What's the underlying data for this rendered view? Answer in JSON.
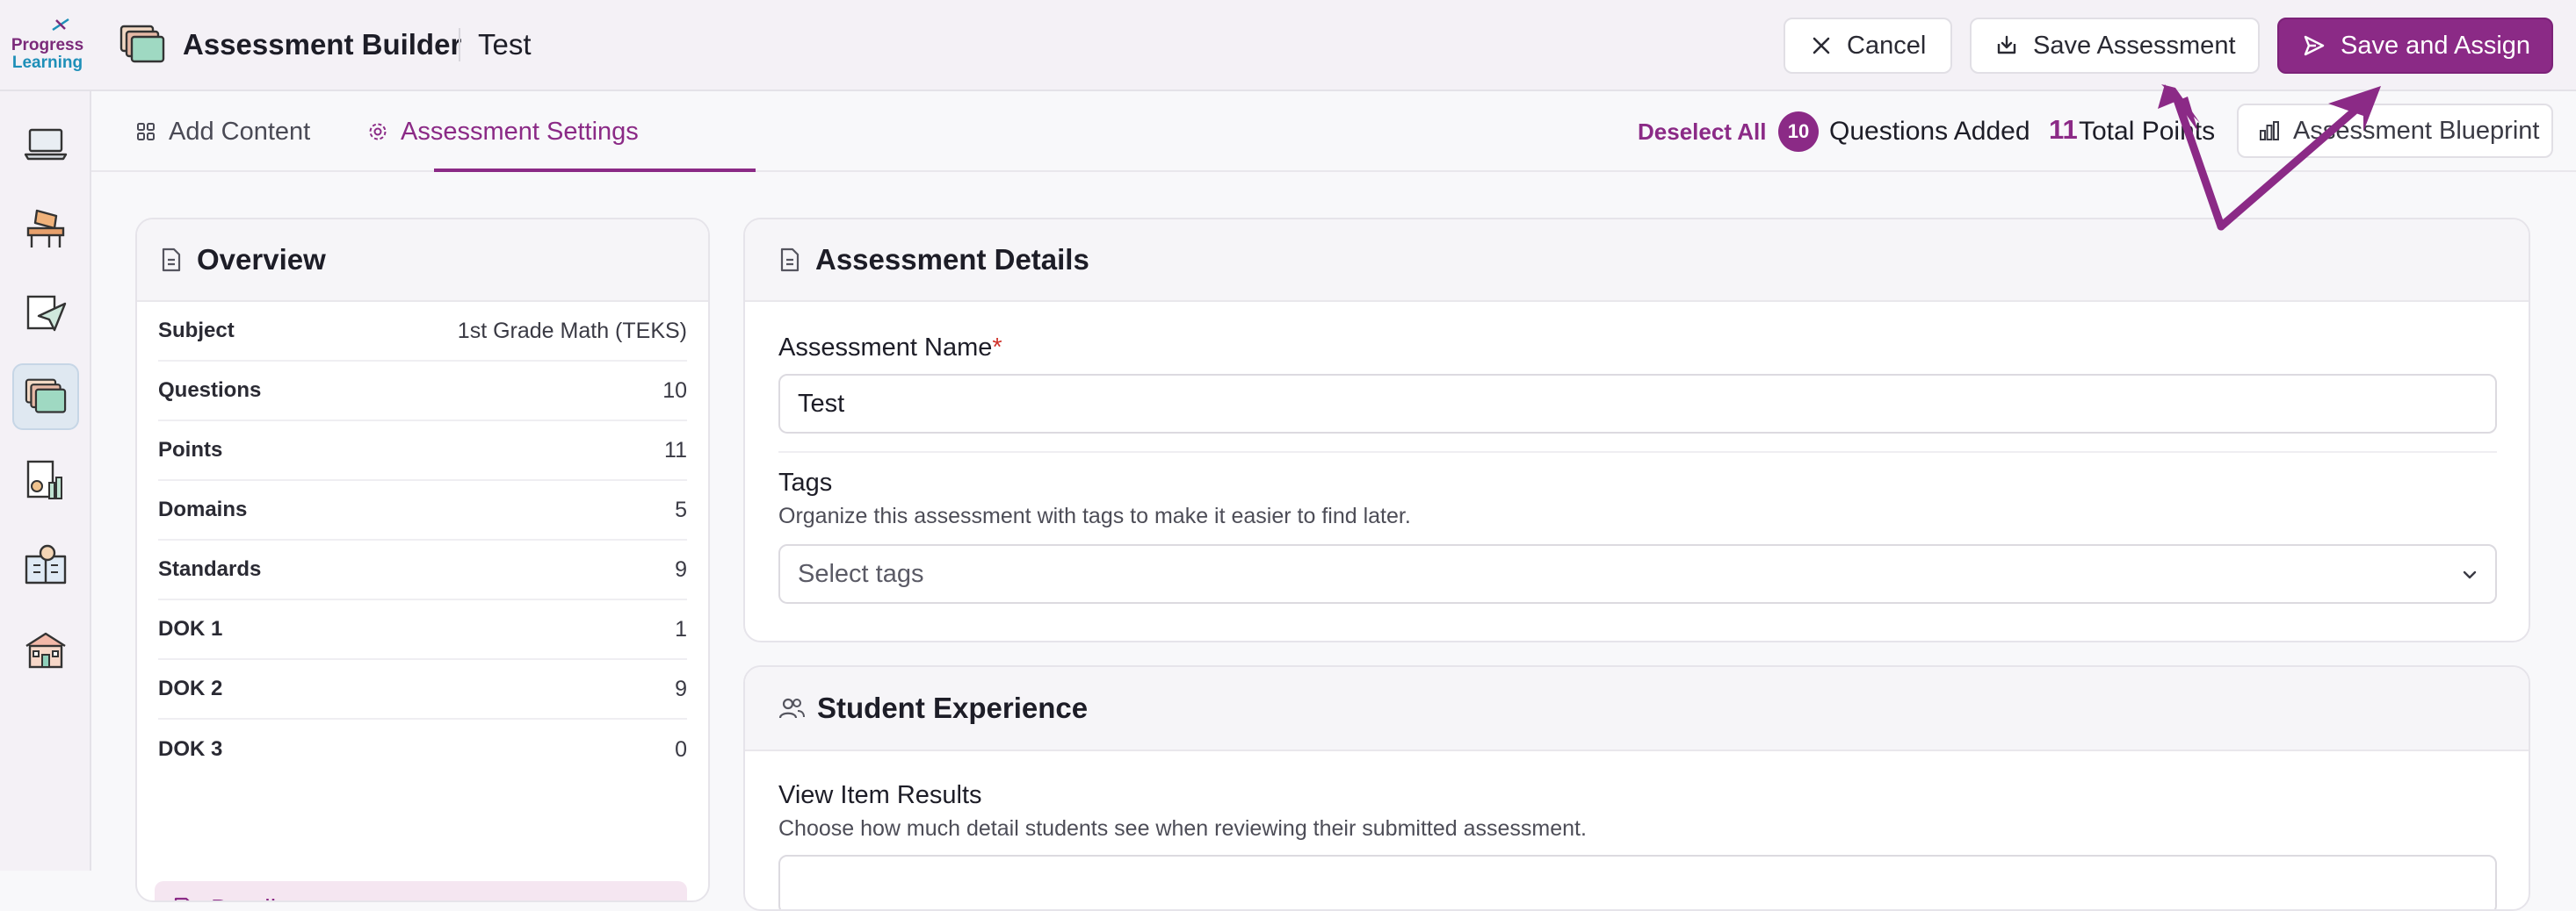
{
  "logo": {
    "line1": "Progress",
    "line2": "Learning"
  },
  "header": {
    "app_title": "Assessment Builder",
    "doc_name": "Test",
    "cancel_label": "Cancel",
    "save_label": "Save Assessment",
    "save_assign_label": "Save and Assign"
  },
  "tabs": [
    {
      "label": "Add Content",
      "active": false
    },
    {
      "label": "Assessment Settings",
      "active": true
    }
  ],
  "toolbar": {
    "deselect_label": "Deselect All",
    "questions_count": "10",
    "questions_label": "Questions Added",
    "points_count": "11",
    "points_label": "Total Points",
    "blueprint_label": "Assessment Blueprint"
  },
  "sidebar": {
    "icons": [
      "laptop-icon",
      "desk-icon",
      "paper-plane-icon",
      "assessment-stack-icon",
      "report-chart-icon",
      "teacher-book-icon",
      "school-icon"
    ],
    "active_index": 3
  },
  "overview": {
    "title": "Overview",
    "rows": [
      {
        "key": "Subject",
        "value": "1st Grade Math (TEKS)"
      },
      {
        "key": "Questions",
        "value": "10"
      },
      {
        "key": "Points",
        "value": "11"
      },
      {
        "key": "Domains",
        "value": "5"
      },
      {
        "key": "Standards",
        "value": "9"
      },
      {
        "key": "DOK 1",
        "value": "1"
      },
      {
        "key": "DOK 2",
        "value": "9"
      },
      {
        "key": "DOK 3",
        "value": "0"
      }
    ],
    "details_label": "Details"
  },
  "assessment_details": {
    "title": "Assessment Details",
    "name_label": "Assessment Name",
    "required_mark": "*",
    "name_value": "Test",
    "tags_label": "Tags",
    "tags_help": "Organize this assessment with tags to make it easier to find later.",
    "tags_placeholder": "Select tags"
  },
  "student_experience": {
    "title": "Student Experience",
    "view_results_label": "View Item Results",
    "view_results_help": "Choose how much detail students see when reviewing their submitted assessment."
  },
  "colors": {
    "accent": "#8b2a86",
    "annotation_arrow": "#8b2a86",
    "required": "#d0342c"
  }
}
